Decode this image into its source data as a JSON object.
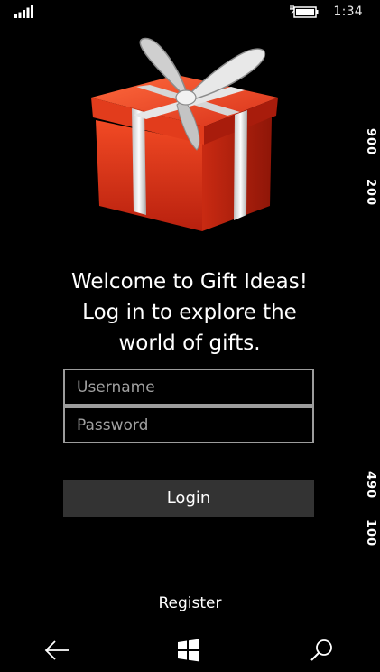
{
  "status_bar": {
    "time": "1:34",
    "signal_icon": "signal-bars-icon",
    "battery_icon": "battery-charging-icon"
  },
  "hero": {
    "image": "gift-box-icon",
    "box_color": "#e8381c",
    "ribbon_color": "#d9d9d9"
  },
  "welcome": {
    "line1": "Welcome to Gift Ideas!",
    "line2": "Log in to explore the",
    "line3": "world of gifts."
  },
  "form": {
    "username_placeholder": "Username",
    "password_placeholder": "Password",
    "login_label": "Login"
  },
  "register_label": "Register",
  "side_labels": [
    "900",
    "200",
    "490",
    "100"
  ],
  "nav_bar": {
    "back_icon": "back-arrow-icon",
    "start_icon": "windows-logo-icon",
    "search_icon": "search-icon"
  }
}
